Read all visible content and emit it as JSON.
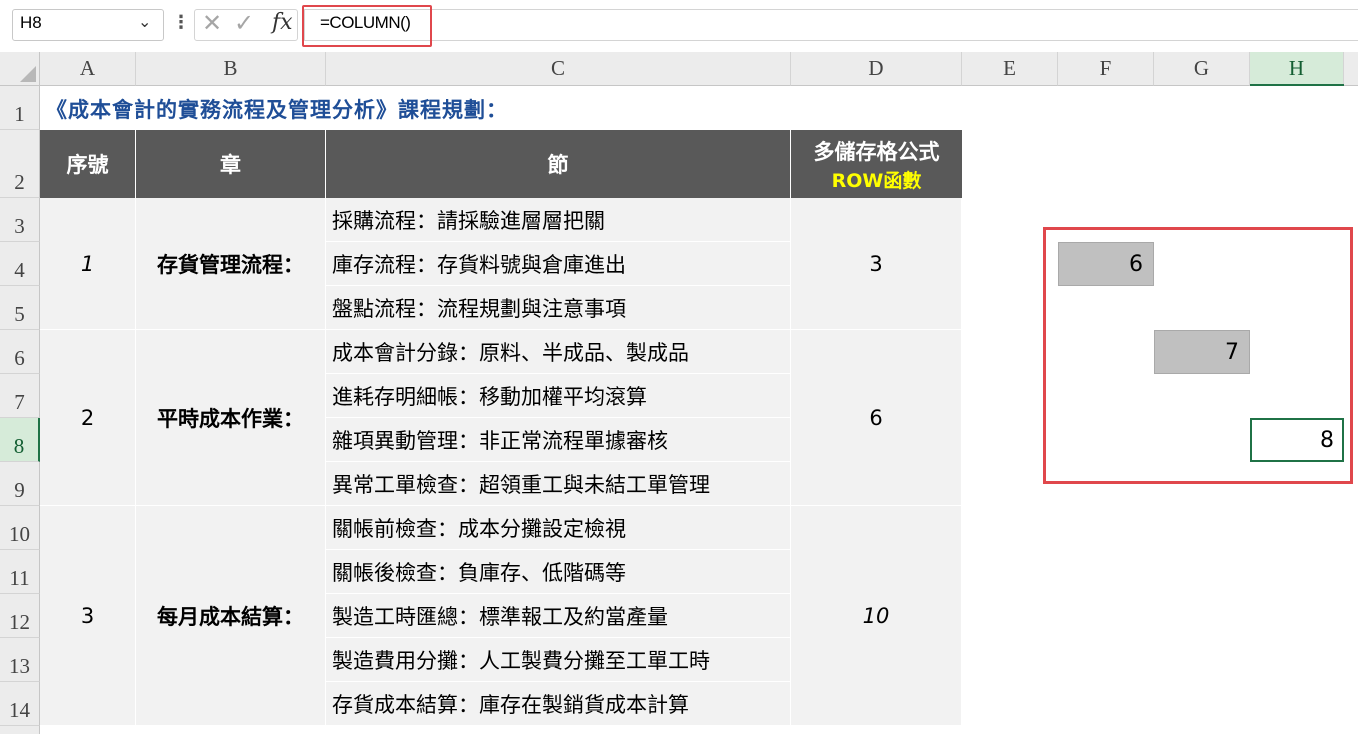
{
  "formula_bar": {
    "name_box": "H8",
    "formula": "=COLUMN()",
    "icons": [
      "chevron-down-icon",
      "kebab-icon",
      "cancel-icon",
      "enter-icon",
      "fx-icon"
    ]
  },
  "columns": [
    "A",
    "B",
    "C",
    "D",
    "E",
    "F",
    "G",
    "H"
  ],
  "rows": [
    "1",
    "2",
    "3",
    "4",
    "5",
    "6",
    "7",
    "8",
    "9",
    "10",
    "11",
    "12",
    "13",
    "14"
  ],
  "sheet": {
    "title": "《成本會計的實務流程及管理分析》課程規劃：",
    "headers": {
      "seq": "序號",
      "chapter": "章",
      "section": "節",
      "formula_l1": "多儲存格公式",
      "formula_l2": "ROW函數"
    },
    "groups": [
      {
        "no": "1",
        "chapter": "存貨管理流程：",
        "value": "3",
        "sections": [
          "採購流程：請採驗進層層把關",
          "庫存流程：存貨料號與倉庫進出",
          "盤點流程：流程規劃與注意事項"
        ]
      },
      {
        "no": "2",
        "chapter": "平時成本作業：",
        "value": "6",
        "sections": [
          "成本會計分錄：原料、半成品、製成品",
          "進耗存明細帳：移動加權平均滾算",
          "雜項異動管理：非正常流程單據審核",
          "異常工單檢查：超領重工與未結工單管理"
        ]
      },
      {
        "no": "3",
        "chapter": "每月成本結算：",
        "value": "10",
        "sections": [
          "關帳前檢查：成本分攤設定檢視",
          "關帳後檢查：負庫存、低階碼等",
          "製造工時匯總：標準報工及約當產量",
          "製造費用分攤：人工製費分攤至工單工時",
          "存貨成本結算：庫存在製銷貨成本計算"
        ]
      }
    ],
    "demo": {
      "f4": "6",
      "g6": "7",
      "h8": "8"
    }
  },
  "colors": {
    "accent_red": "#e0474c",
    "header_dark": "#595959",
    "title_blue": "#1f4e97",
    "row_label_yellow": "#ffff00",
    "excel_green": "#1f7246"
  }
}
